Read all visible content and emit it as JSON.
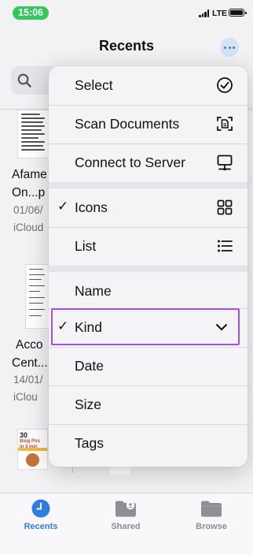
{
  "status_bar": {
    "time": "15:06",
    "network": "LTE",
    "time_pill_color": "#34c759"
  },
  "header": {
    "title": "Recents",
    "more_icon": "ellipsis-circle-icon",
    "search_icon": "search-icon"
  },
  "files": [
    {
      "name_line1": "Afame",
      "name_line2": "On...p",
      "date": "01/06/",
      "location": "iCloud"
    },
    {
      "name_line1": "Acco",
      "name_line2": "Cent...",
      "date": "14/01/",
      "location": "iClou"
    }
  ],
  "promo_thumbnail_text": [
    "30",
    "Blog Pos",
    "in 3 min"
  ],
  "menu": {
    "section1": [
      {
        "label": "Select",
        "icon": "checkmark-circle-icon"
      },
      {
        "label": "Scan Documents",
        "icon": "doc-viewfinder-icon"
      },
      {
        "label": "Connect to Server",
        "icon": "desktop-server-icon"
      }
    ],
    "section2": [
      {
        "label": "Icons",
        "icon": "grid-icon",
        "checked": true
      },
      {
        "label": "List",
        "icon": "list-icon",
        "checked": false
      }
    ],
    "section3": [
      {
        "label": "Name",
        "checked": false
      },
      {
        "label": "Kind",
        "checked": true,
        "icon": "chevron-down-icon",
        "highlighted": true
      },
      {
        "label": "Date",
        "checked": false
      },
      {
        "label": "Size",
        "checked": false
      },
      {
        "label": "Tags",
        "checked": false
      }
    ],
    "checkmark": "✓",
    "highlight_color": "#a54fe6"
  },
  "tab_bar": {
    "accent_color": "#2f7de1",
    "tabs": [
      {
        "label": "Recents",
        "icon": "clock-icon",
        "active": true
      },
      {
        "label": "Shared",
        "icon": "shared-folder-icon",
        "active": false
      },
      {
        "label": "Browse",
        "icon": "folder-icon",
        "active": false
      }
    ]
  }
}
